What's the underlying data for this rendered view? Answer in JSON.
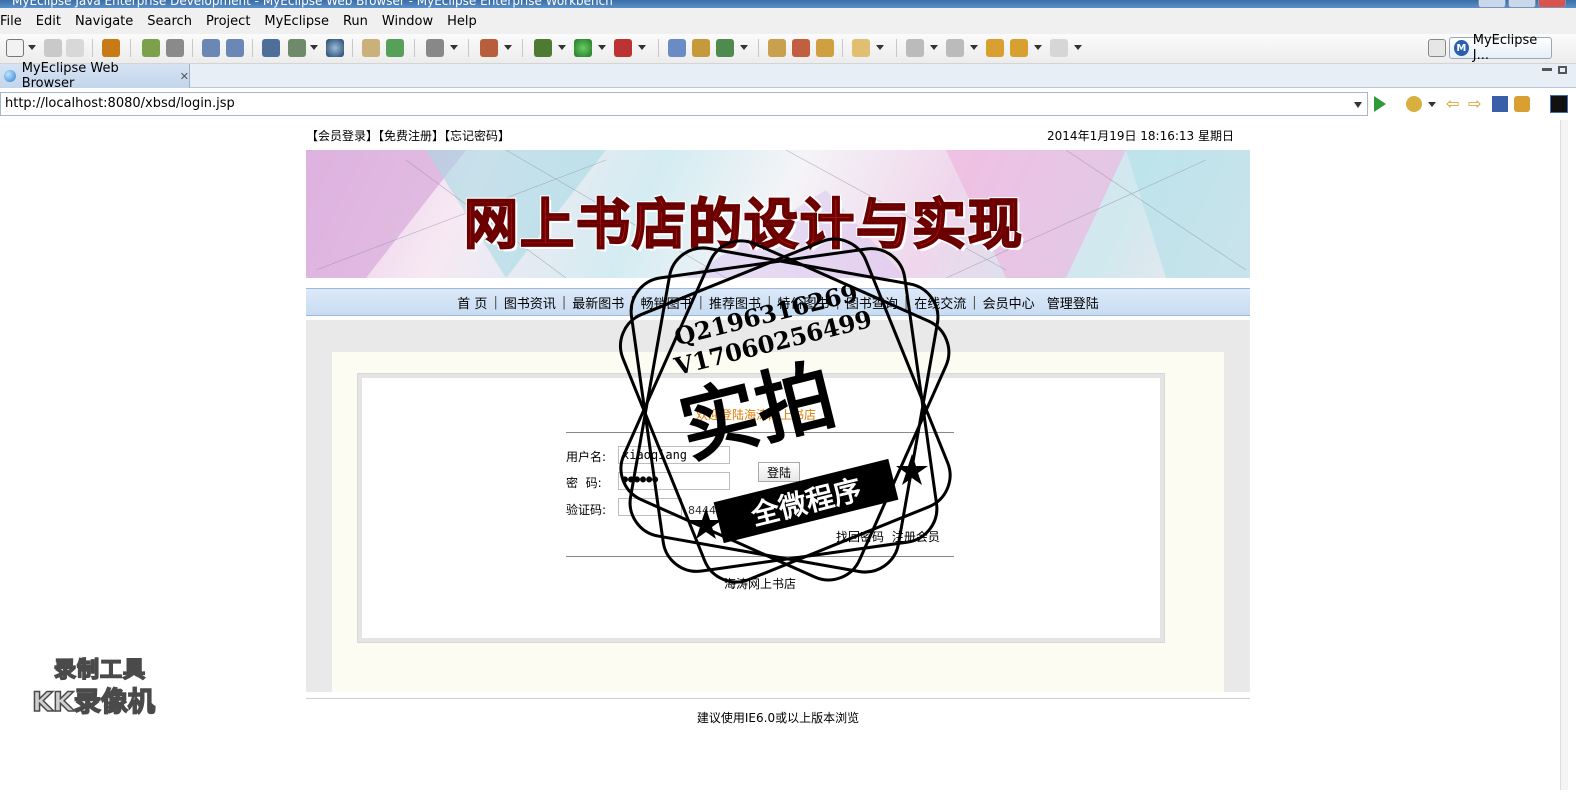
{
  "window": {
    "title": "MyEclipse Java Enterprise Development - MyEclipse Web Browser - MyEclipse Enterprise Workbench"
  },
  "menu": [
    "File",
    "Edit",
    "Navigate",
    "Search",
    "Project",
    "MyEclipse",
    "Run",
    "Window",
    "Help"
  ],
  "perspective": {
    "label": "MyEclipse J..."
  },
  "editor_tab": {
    "label": "MyEclipse Web Browser"
  },
  "address": {
    "url": "http://localhost:8080/xbsd/login.jsp"
  },
  "page": {
    "top_links": "【会员登录】【免费注册】【忘记密码】",
    "datetime": "2014年1月19日  18:16:13  星期日",
    "banner_title": "网上书店的设计与实现",
    "nav": [
      "首 页",
      "图书资讯",
      "最新图书",
      "畅销图书",
      "推荐图书",
      "特价图书",
      "图书查询",
      "在线交流",
      "会员中心",
      "管理登陆"
    ],
    "welcome": "欢迎登陆海涛网上书店",
    "username_label": "用户名:",
    "username_value": "xiaoqiang",
    "password_label": "密  码:",
    "password_value": "●●●●●●",
    "login_button": "登陆",
    "captcha_label": "验证码:",
    "captcha_code": "8444",
    "find_password": "找回密码",
    "register": "注册会员",
    "shop_name": "海涛网上书店",
    "footer": "建议使用IE6.0或以上版本浏览"
  },
  "stamp": {
    "line1": "Q2196316269",
    "line2": "V17060256499",
    "big": "实拍",
    "ribbon": "全微程序"
  },
  "recorder": {
    "line1": "录制工具",
    "line2": "KK录像机"
  }
}
